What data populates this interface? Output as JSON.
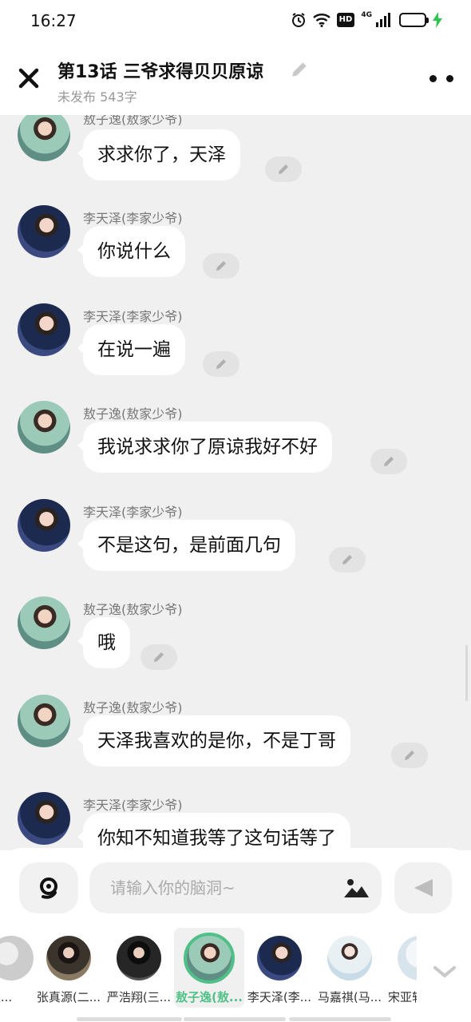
{
  "status_bar": {
    "time": "16:27",
    "hd": "HD",
    "network": "4G"
  },
  "header": {
    "title": "第13话  三爷求得贝贝原谅",
    "subtitle": "未发布 543字"
  },
  "messages": [
    {
      "sender": "敖子逸(敖家少爷)",
      "text": "求求你了，天泽"
    },
    {
      "sender": "李天泽(李家少爷)",
      "text": "你说什么"
    },
    {
      "sender": "李天泽(李家少爷)",
      "text": "在说一遍"
    },
    {
      "sender": "敖子逸(敖家少爷)",
      "text": "我说求求你了原谅我好不好"
    },
    {
      "sender": "李天泽(李家少爷)",
      "text": "不是这句，是前面几句"
    },
    {
      "sender": "敖子逸(敖家少爷)",
      "text": "哦"
    },
    {
      "sender": "敖子逸(敖家少爷)",
      "text": "天泽我喜欢的是你，不是丁哥"
    },
    {
      "sender": "李天泽(李家少爷)",
      "text": "你知不知道我等了这句话等了"
    }
  ],
  "input": {
    "placeholder": "请输入你的脑洞~",
    "value": ""
  },
  "characters": [
    {
      "name": "(太..."
    },
    {
      "name": "张真源(二..."
    },
    {
      "name": "严浩翔(三..."
    },
    {
      "name": "敖子逸(敖...",
      "selected": true
    },
    {
      "name": "李天泽(李..."
    },
    {
      "name": "马嘉祺(马..."
    },
    {
      "name": "宋亚轩"
    }
  ],
  "colors": {
    "accent": "#4fc087",
    "chat_bg": "#f0f0f0",
    "bubble": "#ffffff",
    "battery": "#2ec54f"
  },
  "icons": [
    "close-icon",
    "pencil-icon",
    "more-icon",
    "voice-icon",
    "image-icon",
    "send-icon",
    "chevron-down-icon"
  ]
}
